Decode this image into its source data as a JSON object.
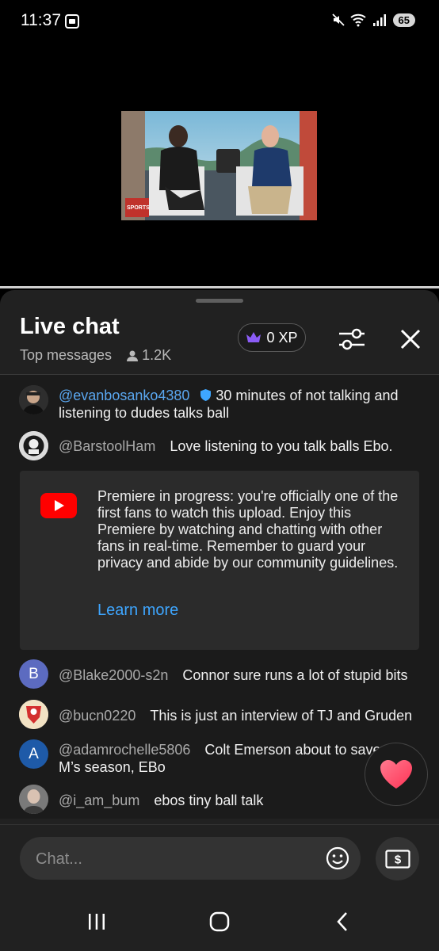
{
  "status_bar": {
    "time": "11:37",
    "battery": "65"
  },
  "video": {
    "description_icon": "video-thumbnail"
  },
  "chat_header": {
    "title": "Live chat",
    "mode": "Top messages",
    "viewer_count": "1.2K",
    "xp_label": "0 XP"
  },
  "messages": [
    {
      "user": "@evanbosanko4380",
      "text": "30 minutes of not talking and listening to dudes talks ball",
      "member": true
    },
    {
      "user": "@BarstoolHam",
      "text": "Love listening to you talk balls Ebo."
    },
    {
      "user": "@Blake2000-s2n",
      "text": "Connor sure runs a lot of stupid bits",
      "avatar_letter": "B",
      "avatar_color": "#5c6bc0"
    },
    {
      "user": "@bucn0220",
      "text": "This is just an interview of TJ and Gruden"
    },
    {
      "user": "@adamrochelle5806",
      "text": "Colt Emerson about to save the M’s season, EBo",
      "avatar_letter": "A",
      "avatar_color": "#1e5aa8"
    },
    {
      "user": "@i_am_bum",
      "text": "ebos tiny ball talk"
    }
  ],
  "notice": {
    "text": "Premiere in progress: you're officially one of the first fans to watch this upload. Enjoy this Premiere by watching and chatting with other fans in real-time. Remember to guard your privacy and abide by our community guidelines.",
    "link": "Learn more"
  },
  "input": {
    "placeholder": "Chat..."
  },
  "colors": {
    "accent_blue": "#3ea6ff",
    "youtube_red": "#ff0000",
    "heart": "#ff4d6d"
  }
}
